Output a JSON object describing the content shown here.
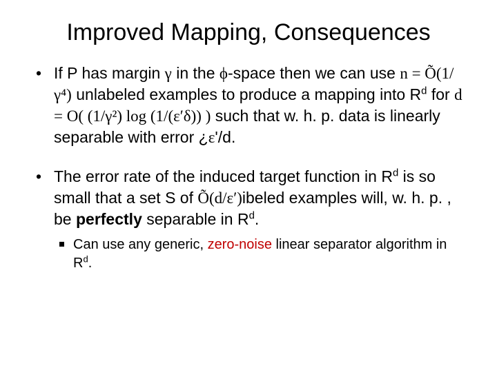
{
  "title": "Improved Mapping, Consequences",
  "b1": {
    "t1": "If P has margin ",
    "gamma": "γ",
    "t2": " in the ",
    "phi": "ϕ",
    "t3": "-space then we can use ",
    "n_expr": "n = Õ(1/γ⁴)",
    "t4": " unlabeled examples to produce a mapping into R",
    "d1": "d",
    "t5": " for ",
    "d_expr": "d = O( (1/γ²) log (1/(ε′δ)) )",
    "t6": " such that w. h. p. data is linearly separable with error ¿",
    "eps": "ε",
    "t7": "'/d."
  },
  "b2": {
    "t1": "The error rate of the induced target function in R",
    "d1": "d",
    "t2": " is so small that a set S of ",
    "expr": "Õ(d/ε′)",
    "t3": "ibeled examples will, w. h. p. , be ",
    "bold": "perfectly",
    "t4": " separable in R",
    "d2": "d",
    "t5": "."
  },
  "s1": {
    "t1": "Can use any generic, ",
    "red": "zero-noise",
    "t2": " linear separator algorithm in R",
    "d": "d",
    "t3": "."
  }
}
